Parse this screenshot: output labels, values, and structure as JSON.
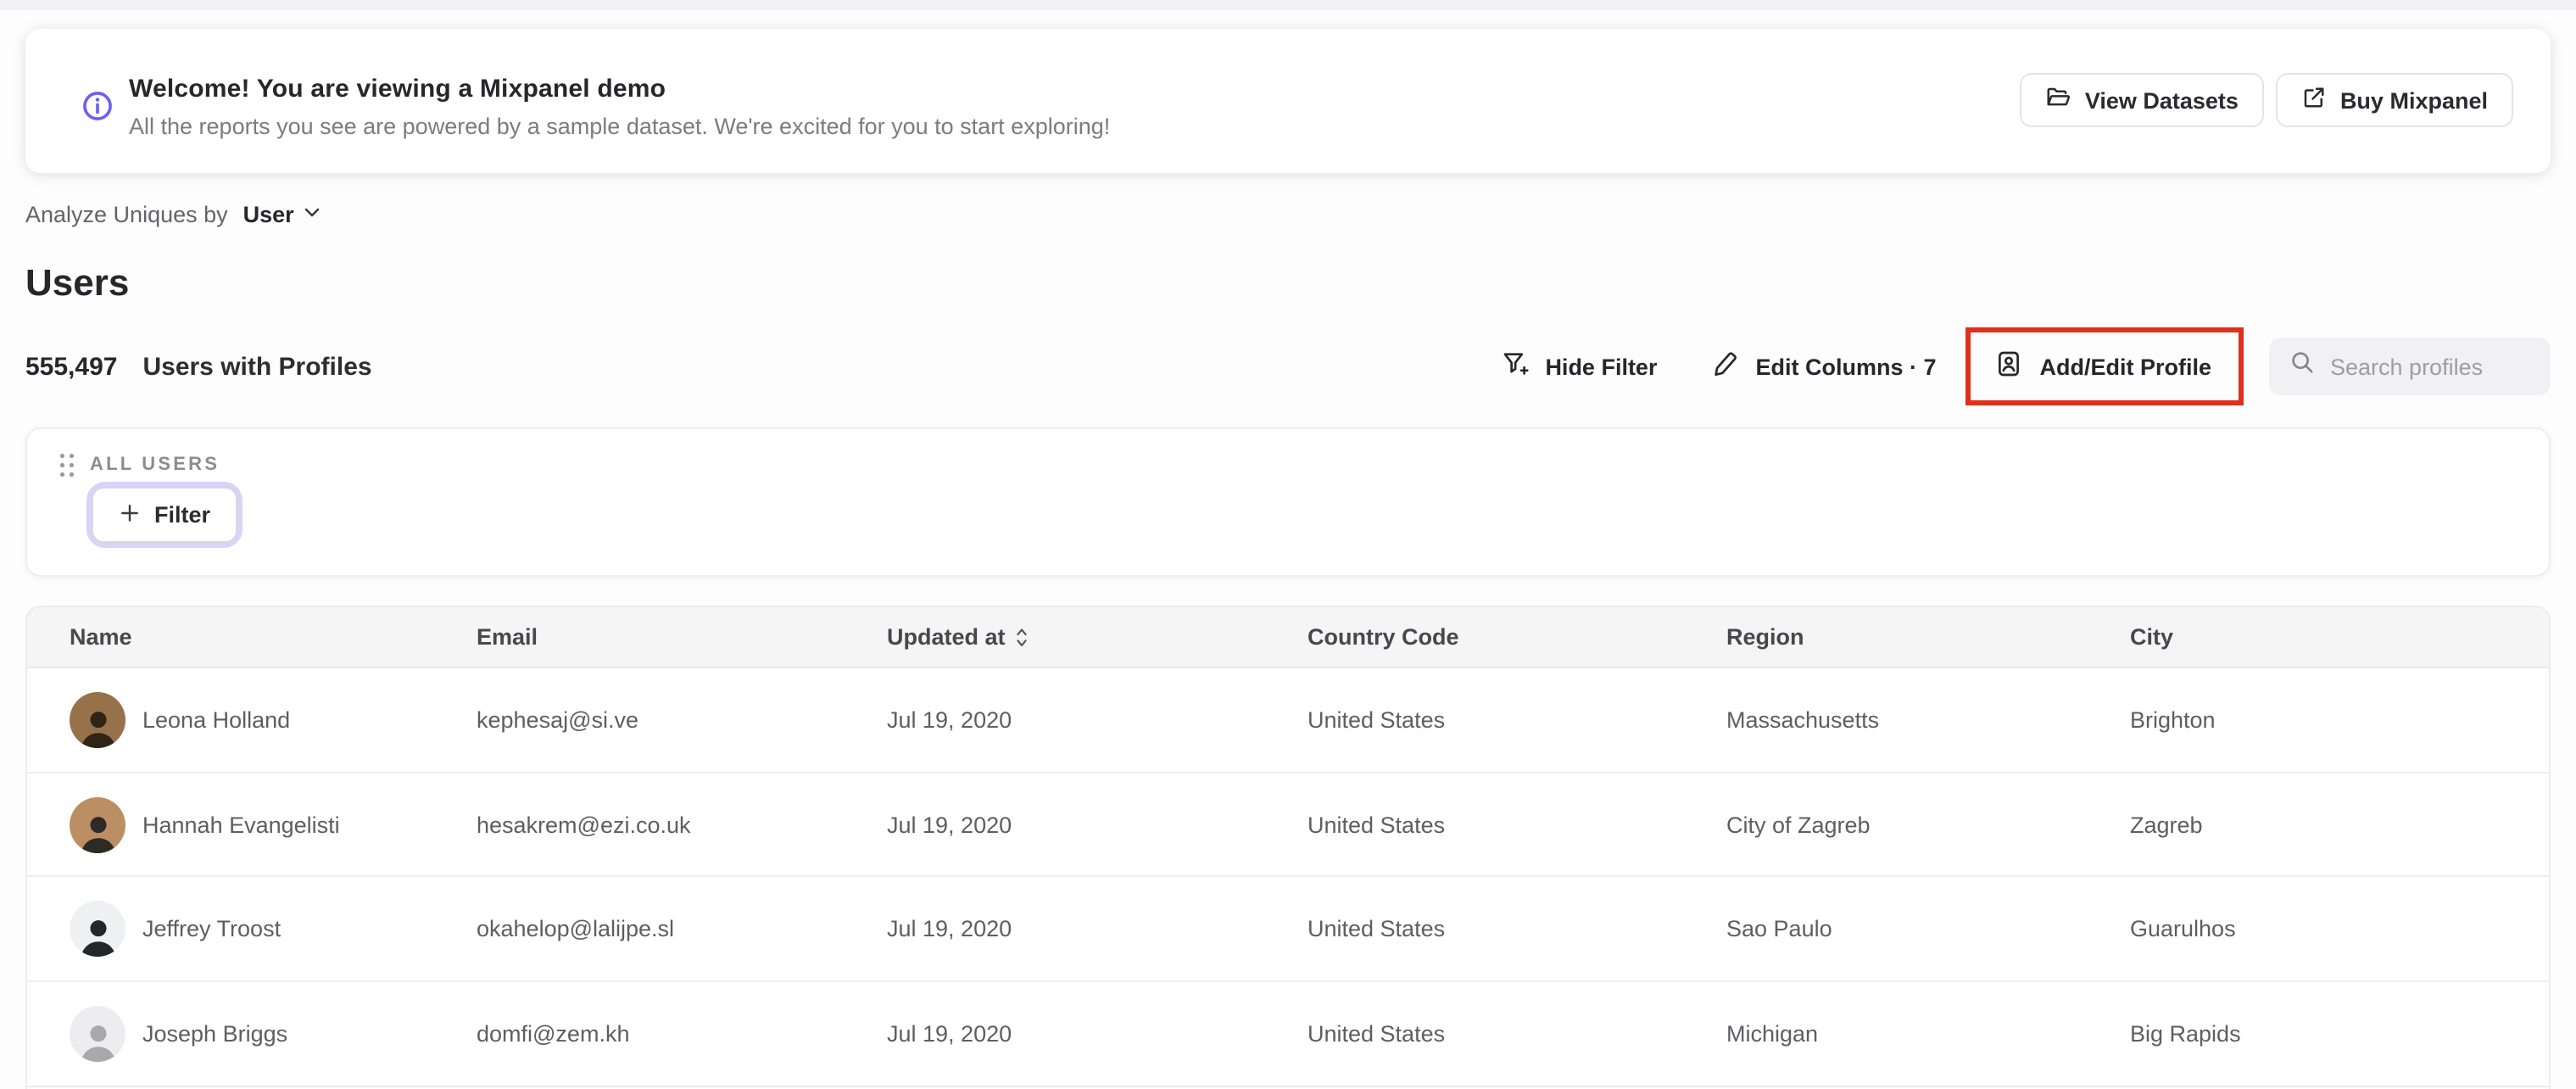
{
  "banner": {
    "title": "Welcome! You are viewing a Mixpanel demo",
    "subtitle": "All the reports you see are powered by a sample dataset. We're excited for you to start exploring!",
    "view_datasets_label": "View Datasets",
    "buy_mixpanel_label": "Buy Mixpanel"
  },
  "controls": {
    "analyze_label": "Analyze Uniques by",
    "analyze_value": "User"
  },
  "page_title": "Users",
  "summary": {
    "count": "555,497",
    "label": "Users with Profiles"
  },
  "toolbar": {
    "hide_filter_label": "Hide Filter",
    "edit_columns_label": "Edit Columns · 7",
    "add_edit_profile_label": "Add/Edit Profile",
    "search_placeholder": "Search profiles"
  },
  "filter_panel": {
    "group_label": "ALL USERS",
    "filter_button_label": "Filter"
  },
  "table": {
    "columns": [
      "Name",
      "Email",
      "Updated at",
      "Country Code",
      "Region",
      "City"
    ],
    "sorted_column": "Updated at",
    "rows": [
      {
        "name": "Leona Holland",
        "email": "kephesaj@si.ve",
        "updated_at": "Jul 19, 2020",
        "country_code": "United States",
        "region": "Massachusetts",
        "city": "Brighton",
        "avatar_bg": "#96714a",
        "avatar_fg": "#2f2416"
      },
      {
        "name": "Hannah Evangelisti",
        "email": "hesakrem@ezi.co.uk",
        "updated_at": "Jul 19, 2020",
        "country_code": "United States",
        "region": "City of Zagreb",
        "city": "Zagreb",
        "avatar_bg": "#bb8f63",
        "avatar_fg": "#2e2a26"
      },
      {
        "name": "Jeffrey Troost",
        "email": "okahelop@lalijpe.sl",
        "updated_at": "Jul 19, 2020",
        "country_code": "United States",
        "region": "Sao Paulo",
        "city": "Guarulhos",
        "avatar_bg": "#eef0f2",
        "avatar_fg": "#23262b"
      },
      {
        "name": "Joseph Briggs",
        "email": "domfi@zem.kh",
        "updated_at": "Jul 19, 2020",
        "country_code": "United States",
        "region": "Michigan",
        "city": "Big Rapids",
        "avatar_bg": "#ededef",
        "avatar_fg": "#a8a8ae"
      }
    ]
  },
  "colors": {
    "accent_purple": "#6a5ff5",
    "highlight_red": "#e0301c",
    "focus_ring": "#d8d3f8"
  }
}
